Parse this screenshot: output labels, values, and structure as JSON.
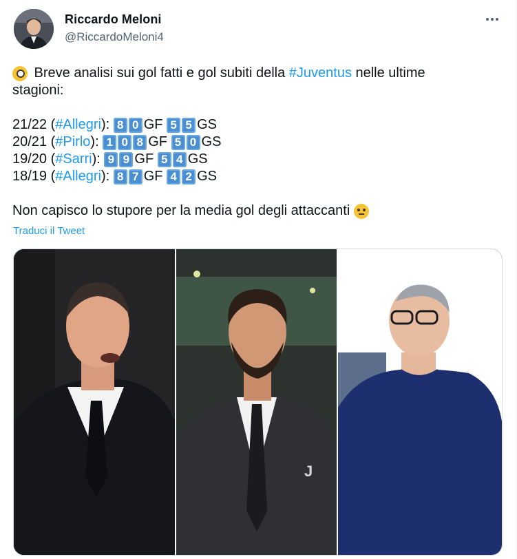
{
  "author": {
    "name": "Riccardo Meloni",
    "handle": "@RiccardoMeloni4"
  },
  "tweet": {
    "intro_text": " Breve analisi sui gol fatti e gol subiti della ",
    "intro_tag": "#Juventus",
    "intro_after": " nelle ultime",
    "intro_line2": "stagioni:",
    "seasons": [
      {
        "season": "21/22 (",
        "tag": "#Allegri",
        "close": "): ",
        "gf": [
          "8",
          "0"
        ],
        "gf_label": "GF ",
        "gs": [
          "5",
          "5"
        ],
        "gs_label": "GS"
      },
      {
        "season": "20/21 (",
        "tag": "#Pirlo",
        "close": "): ",
        "gf": [
          "1",
          "0",
          "8"
        ],
        "gf_label": "GF ",
        "gs": [
          "5",
          "0"
        ],
        "gs_label": "GS"
      },
      {
        "season": "19/20 (",
        "tag": "#Sarri",
        "close": "): ",
        "gf": [
          "9",
          "9"
        ],
        "gf_label": "GF ",
        "gs": [
          "5",
          "4"
        ],
        "gs_label": "GS"
      },
      {
        "season": "18/19 (",
        "tag": "#Allegri",
        "close": "): ",
        "gf": [
          "8",
          "7"
        ],
        "gf_label": "GF ",
        "gs": [
          "4",
          "2"
        ],
        "gs_label": "GS"
      }
    ],
    "closing": "Non capisco lo stupore per la media gol degli attaccanti",
    "translate": "Traduci il Tweet"
  },
  "media": {
    "photos": [
      "allegri-photo",
      "pirlo-photo",
      "sarri-photo"
    ]
  },
  "colors": {
    "link": "#1d9bf0",
    "keycap": "#4a8fd1",
    "secondary": "#536471"
  }
}
